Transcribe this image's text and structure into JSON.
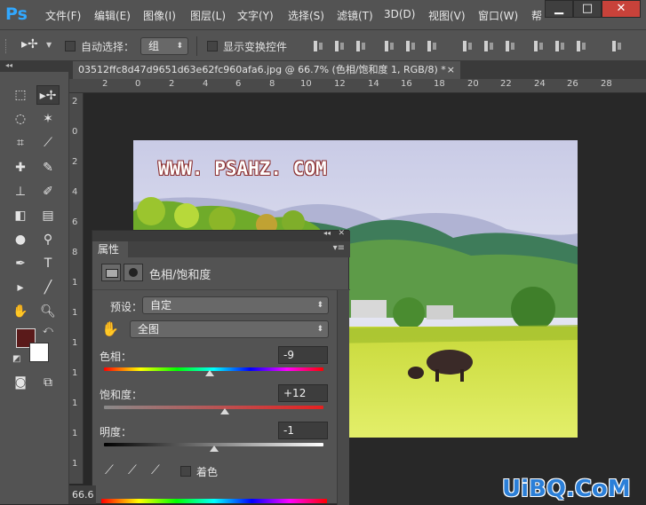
{
  "app": {
    "logo": "Ps"
  },
  "menu": [
    "文件(F)",
    "编辑(E)",
    "图像(I)",
    "图层(L)",
    "文字(Y)",
    "选择(S)",
    "滤镜(T)",
    "3D(D)",
    "视图(V)",
    "窗口(W)",
    "帮"
  ],
  "window_controls": {
    "minimize": "▁",
    "maximize": "□",
    "close": "✕"
  },
  "options_bar": {
    "auto_select_label": "自动选择：",
    "auto_select_value": "组",
    "show_transform_label": "显示变换控件"
  },
  "document": {
    "tab_title": "03512ffc8d47d9651d63e62fc960afa6.jpg @ 66.7% (色相/饱和度 1, RGB/8) *",
    "tab_close": "×",
    "ruler_h_labels": [
      "2",
      "0",
      "2",
      "4",
      "6",
      "8",
      "10",
      "12",
      "14",
      "16",
      "18",
      "20",
      "22",
      "24",
      "26",
      "28"
    ],
    "ruler_v_labels": [
      "2",
      "0",
      "2",
      "4",
      "6",
      "8",
      "1",
      "1",
      "1",
      "1",
      "1",
      "1",
      "1"
    ],
    "zoom_status": "66.6"
  },
  "photo": {
    "watermark_text": "WWW. PSAHZ. COM"
  },
  "colors": {
    "foreground": "#5a1a1a",
    "background": "#ffffff",
    "accent": "#31a8ff"
  },
  "properties": {
    "panel_title": "属性",
    "adjustment_name": "色相/饱和度",
    "preset_label": "预设：",
    "preset_value": "自定",
    "channel_value": "全图",
    "hue": {
      "label": "色相：",
      "value": "-9",
      "position": 0.48
    },
    "saturation": {
      "label": "饱和度：",
      "value": "+12",
      "position": 0.55
    },
    "lightness": {
      "label": "明度：",
      "value": "-1",
      "position": 0.5
    },
    "colorize_label": "着色"
  },
  "watermark": "UiBQ.CoM"
}
